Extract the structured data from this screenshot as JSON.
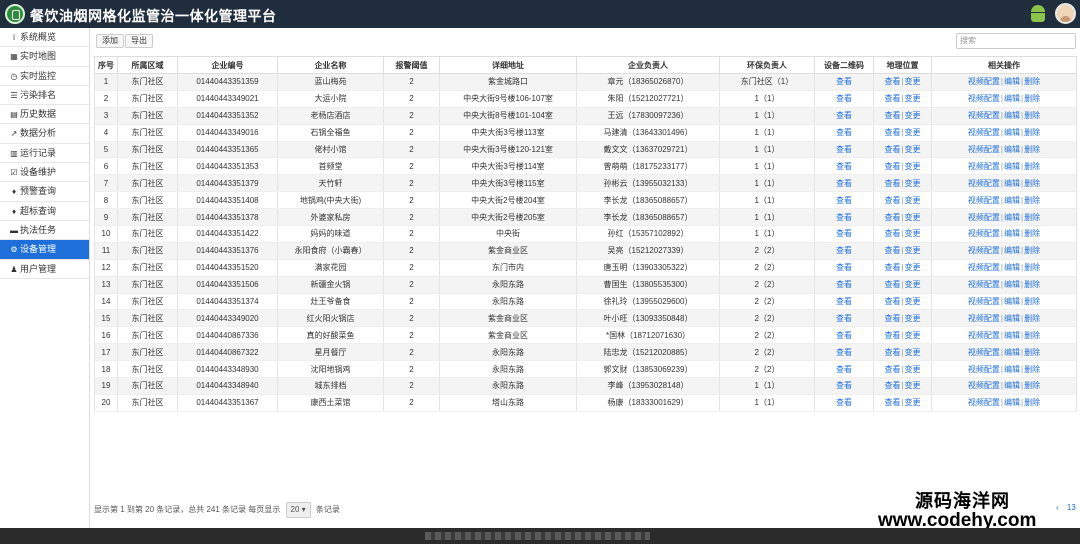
{
  "header": {
    "title": "餐饮油烟网格化监管治一体化管理平台"
  },
  "sidebar": {
    "items": [
      {
        "icon": "i",
        "label": "系统概览"
      },
      {
        "icon": "▦",
        "label": "实时地图"
      },
      {
        "icon": "◷",
        "label": "实时监控"
      },
      {
        "icon": "☰",
        "label": "污染排名"
      },
      {
        "icon": "▤",
        "label": "历史数据"
      },
      {
        "icon": "↗",
        "label": "数据分析"
      },
      {
        "icon": "▥",
        "label": "运行记录"
      },
      {
        "icon": "☑",
        "label": "设备维护"
      },
      {
        "icon": "♦",
        "label": "预警查询"
      },
      {
        "icon": "♦",
        "label": "超标查询"
      },
      {
        "icon": "▬",
        "label": "执法任务"
      },
      {
        "icon": "⚙",
        "label": "设备管理"
      },
      {
        "icon": "♟",
        "label": "用户管理"
      }
    ],
    "active_index": 11
  },
  "toolbar": {
    "add_label": "添加",
    "export_label": "导出",
    "search_placeholder": "搜索"
  },
  "table": {
    "columns": [
      "序号",
      "所属区域",
      "企业编号",
      "企业名称",
      "报警阈值",
      "详细地址",
      "企业负责人",
      "环保负责人",
      "设备二维码",
      "地理位置",
      "相关操作"
    ],
    "rows": [
      [
        "1",
        "东门社区",
        "01440443351359",
        "蓝山梅苑",
        "2",
        "紫金城路口",
        "章元（18365026870）",
        "东门社区（1）",
        "查看",
        "查看|变更",
        "视频配置|编辑|删除"
      ],
      [
        "2",
        "东门社区",
        "01440443349021",
        "大运小院",
        "2",
        "中央大街9号楼106-107室",
        "朱阳（15212027721）",
        "1（1）",
        "查看",
        "查看|变更",
        "视频配置|编辑|删除"
      ],
      [
        "3",
        "东门社区",
        "01440443351352",
        "老杨店酒店",
        "2",
        "中央大街8号楼101-104室",
        "王远（17830097236）",
        "1（1）",
        "查看",
        "查看|变更",
        "视频配置|编辑|删除"
      ],
      [
        "4",
        "东门社区",
        "01440443349016",
        "石锅全福鱼",
        "2",
        "中央大街3号楼113室",
        "马建清（13643301496）",
        "1（1）",
        "查看",
        "查看|变更",
        "视频配置|编辑|删除"
      ],
      [
        "5",
        "东门社区",
        "01440443351365",
        "佬村小馆",
        "2",
        "中央大街3号楼120-121室",
        "戴文文（13637029721）",
        "1（1）",
        "查看",
        "查看|变更",
        "视频配置|编辑|删除"
      ],
      [
        "6",
        "东门社区",
        "01440443351353",
        "首频堂",
        "2",
        "中央大街3号楼114室",
        "曾萌萌（18175233177）",
        "1（1）",
        "查看",
        "查看|变更",
        "视频配置|编辑|删除"
      ],
      [
        "7",
        "东门社区",
        "01440443351379",
        "天竹轩",
        "2",
        "中央大街3号楼115室",
        "孙彬云（13955032133）",
        "1（1）",
        "查看",
        "查看|变更",
        "视频配置|编辑|删除"
      ],
      [
        "8",
        "东门社区",
        "01440443351408",
        "地锅鸡(中央大街)",
        "2",
        "中央大街2号楼204室",
        "李长龙（18365088657）",
        "1（1）",
        "查看",
        "查看|变更",
        "视频配置|编辑|删除"
      ],
      [
        "9",
        "东门社区",
        "01440443351378",
        "外婆家私房",
        "2",
        "中央大街2号楼205室",
        "李长龙（18365088657）",
        "1（1）",
        "查看",
        "查看|变更",
        "视频配置|编辑|删除"
      ],
      [
        "10",
        "东门社区",
        "01440443351422",
        "妈妈的味道",
        "2",
        "中央街",
        "孙红（15357102892）",
        "1（1）",
        "查看",
        "查看|变更",
        "视频配置|编辑|删除"
      ],
      [
        "11",
        "东门社区",
        "01440443351376",
        "永阳食府（小霸春）",
        "2",
        "紫金商业区",
        "吴亮（15212027339）",
        "2（2）",
        "查看",
        "查看|变更",
        "视频配置|编辑|删除"
      ],
      [
        "12",
        "东门社区",
        "01440443351520",
        "满家花园",
        "2",
        "东门市内",
        "唐玉明（13903305322）",
        "2（2）",
        "查看",
        "查看|变更",
        "视频配置|编辑|删除"
      ],
      [
        "13",
        "东门社区",
        "01440443351506",
        "新疆金火锅",
        "2",
        "永阳东路",
        "曹国生（13805535300）",
        "2（2）",
        "查看",
        "查看|变更",
        "视频配置|编辑|删除"
      ],
      [
        "14",
        "东门社区",
        "01440443351374",
        "灶王爷备食",
        "2",
        "永阳东路",
        "徐礼玲（13955029600）",
        "2（2）",
        "查看",
        "查看|变更",
        "视频配置|编辑|删除"
      ],
      [
        "15",
        "东门社区",
        "01440443349020",
        "红火阳火锅店",
        "2",
        "紫金商业区",
        "叶小旺（13093350848）",
        "2（2）",
        "查看",
        "查看|变更",
        "视频配置|编辑|删除"
      ],
      [
        "16",
        "东门社区",
        "01440440867336",
        "真的好酸菜鱼",
        "2",
        "紫金商业区",
        "*国林（18712071630）",
        "2（2）",
        "查看",
        "查看|变更",
        "视频配置|编辑|删除"
      ],
      [
        "17",
        "东门社区",
        "01440440867322",
        "星月餐厅",
        "2",
        "永阳东路",
        "陆忠龙（15212020885）",
        "2（2）",
        "查看",
        "查看|变更",
        "视频配置|编辑|删除"
      ],
      [
        "18",
        "东门社区",
        "01440443348930",
        "沈阳地锅鸡",
        "2",
        "永阳东路",
        "郭文财（13853069239）",
        "2（2）",
        "查看",
        "查看|变更",
        "视频配置|编辑|删除"
      ],
      [
        "19",
        "东门社区",
        "01440443348940",
        "城东排档",
        "2",
        "永阳东路",
        "李峰（13953028148）",
        "1（1）",
        "查看",
        "查看|变更",
        "视频配置|编辑|删除"
      ],
      [
        "20",
        "东门社区",
        "01440443351367",
        "康西土菜馆",
        "2",
        "塔山东路",
        "杨康（18333001629）",
        "1（1）",
        "查看",
        "查看|变更",
        "视频配置|编辑|删除"
      ]
    ]
  },
  "footer": {
    "summary_prefix": "显示第 1 到第 20 条记录，总共 241 条记录 每页显示",
    "page_size": "20",
    "summary_suffix": "条记录",
    "pager_left": "‹",
    "pager_right": "13"
  },
  "watermark": {
    "line1": "源码海洋网",
    "line2": "www.codehy.com"
  }
}
